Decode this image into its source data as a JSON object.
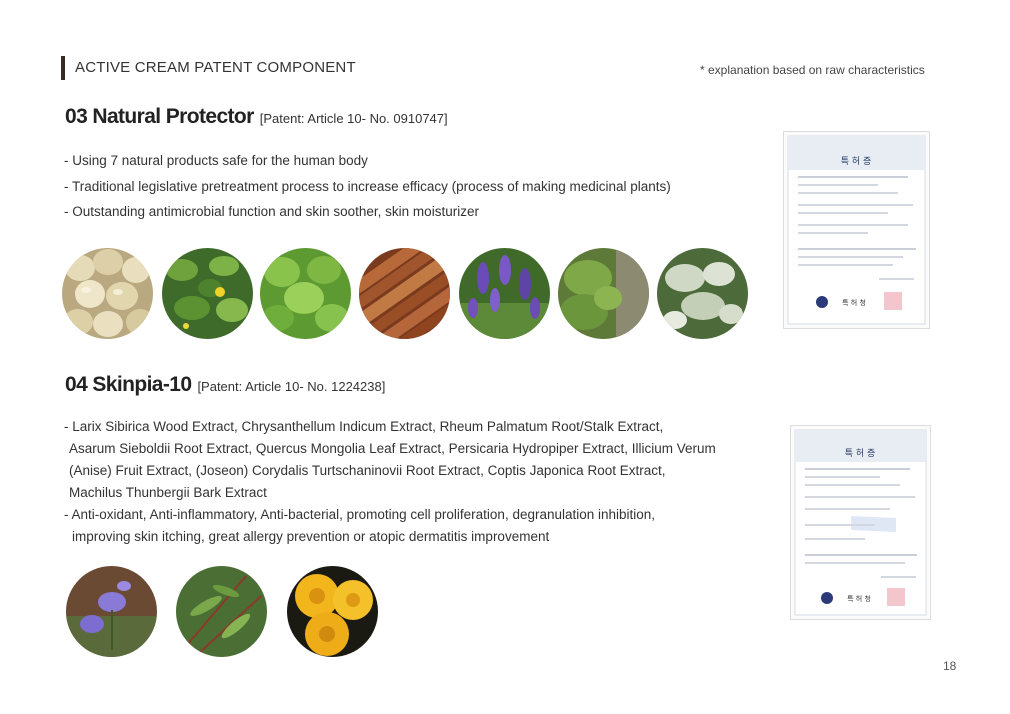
{
  "header": {
    "title": "ACTIVE CREAM PATENT COMPONENT",
    "note": "* explanation based on raw characteristics"
  },
  "section1": {
    "title": "03 Natural Protector",
    "patent": "[Patent: Article 10- No. 0910747]",
    "lines": [
      "- Using 7 natural products safe for the human body",
      "- Traditional legislative pretreatment process to increase efficacy (process of making medicinal plants)",
      "- Outstanding antimicrobial function and skin soother, skin moisturizer"
    ]
  },
  "section2": {
    "title": "04 Skinpia-10",
    "patent": "[Patent: Article 10- No. 1224238]",
    "lines": [
      "- Larix Sibirica Wood Extract, Chrysanthellum Indicum Extract, Rheum Palmatum Root/Stalk Extract,",
      "Asarum Sieboldii Root Extract, Quercus Mongolia Leaf Extract, Persicaria Hydropiper Extract, Illicium Verum",
      "(Anise) Fruit Extract, (Joseon) Corydalis Turtschaninovii Root Extract, Coptis Japonica Root Extract,",
      "Machilus Thunbergii Bark Extract",
      "- Anti-oxidant, Anti-inflammatory, Anti-bacterial, promoting cell proliferation, degranulation inhibition,",
      "improving skin itching,  great allergy prevention or atopic dermatitis improvement"
    ]
  },
  "certificate": {
    "heading": "특 허 증",
    "issuer": "특 허 청"
  },
  "page_number": "18",
  "colors": {
    "header_bar": "#3b2a20",
    "text": "#333333"
  }
}
